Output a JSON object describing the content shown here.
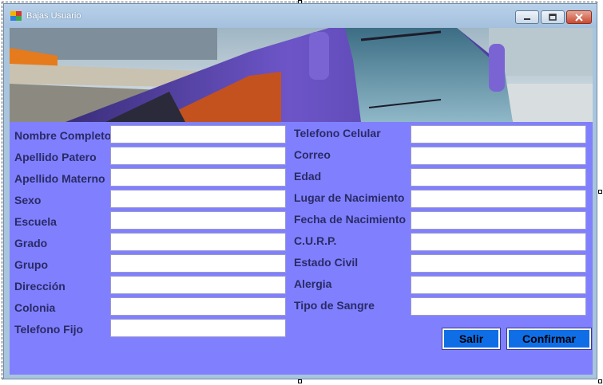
{
  "window": {
    "title": "Bajas Usuario"
  },
  "form_left": {
    "labels": [
      "Nombre Completo",
      "Apellido Patero",
      "Apellido Materno",
      "Sexo",
      "Escuela",
      "Grado",
      "Grupo",
      "Dirección",
      "Colonia",
      "Telefono Fijo"
    ],
    "values": [
      "",
      "",
      "",
      "",
      "",
      "",
      "",
      "",
      "",
      ""
    ]
  },
  "form_right": {
    "labels": [
      "Telefono Celular",
      "Correo",
      "Edad",
      "Lugar de Nacimiento",
      "Fecha de Nacimiento",
      "C.U.R.P.",
      "Estado Civil",
      "Alergia",
      "Tipo de Sangre"
    ],
    "values": [
      "",
      "",
      "",
      "",
      "",
      "",
      "",
      "",
      ""
    ]
  },
  "buttons": {
    "exit": "Salir",
    "confirm": "Confirmar"
  },
  "colors": {
    "form_background": "#8080ff",
    "button": "#0f6ee6",
    "field": "#ffffff"
  },
  "icons": {
    "app": "app-window-icon",
    "minimize": "minimize-icon",
    "maximize": "maximize-icon",
    "close": "close-icon"
  }
}
